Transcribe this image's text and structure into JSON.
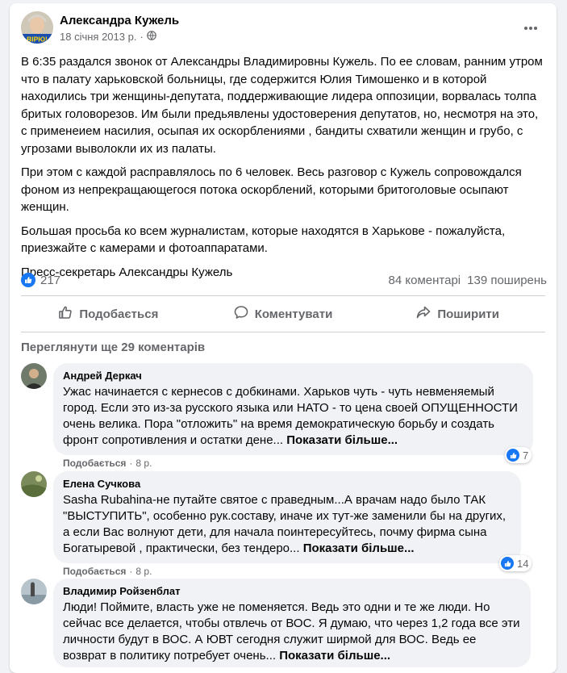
{
  "post": {
    "author": "Александра Кужель",
    "avatar_badge": "ВІРЮ!",
    "date": "18 січня 2013 р.",
    "separator": "·",
    "privacy_icon": "globe-icon",
    "more_icon": "more-horizontal-icon",
    "paragraphs": [
      "В 6:35 раздался звонок от Александры Владимировны Кужель. По ее словам, ранним утром что в палату  харьковской больницы, где содержится Юлия Тимошенко и в которой находились три женщины-депутата, поддерживающие лидера оппозиции,  ворвалась толпа бритых головорезов. Им были предьявлены удостоверения депутатов, но, несмотря на это, с применеием насилия, осыпая их  оскорблениями  , бандиты  схватили    женщин  и грубо, с угрозами    выволокли их из палаты.",
      "При этом с каждой расправлялось по 6 человек. Весь разговор с Кужель сопровождался фоном из непрекращающегося потока оскорблений, которыми бритоголовые осыпают женщин.",
      " Большая просьба ко всем журналистам, которые находятся в Харькове - пожалуйста, приезжайте с камерами и фотоаппаратами.",
      "Пресс-секретарь  Александры Кужель"
    ]
  },
  "stats": {
    "reactions": "217",
    "comments": "84 коментарі",
    "shares": "139 поширень"
  },
  "actions": {
    "like": "Подобається",
    "comment": "Коментувати",
    "share": "Поширити"
  },
  "view_more_comments": "Переглянути ще 29 коментарів",
  "comments": [
    {
      "author": "Андрей Деркач",
      "text": "Ужас начинается с кернесов с добкинами. Харьков чуть - чуть невменяемый город. Если это из-за русского языка или НАТО - то цена своей ОПУЩЕННОСТИ очень велика. Пора \"отложить\" на время демократическую борьбу и создать фронт сопротивления и остатки дене... ",
      "see_more": "Показати більше...",
      "reactions": "7",
      "like_label": "Подобається",
      "dot": "·",
      "time": "8 р."
    },
    {
      "author": "Елена Сучкова",
      "text": "Sasha Rubahina-не путайте святое с праведным...А врачам надо было ТАК \"ВЫСТУПИТЬ\", особенно рук.составу, иначе их тут-же заменили бы на других, а если Вас волнуют дети, для начала поинтересуйтесь, почму фирма сына Богатыревой , практически, без тендеро... ",
      "see_more": "Показати більше...",
      "reactions": "14",
      "like_label": "Подобається",
      "dot": "·",
      "time": "8 р."
    },
    {
      "author": "Владимир Ройзенблат",
      "text": "Люди! Поймите, власть уже не поменяется. Ведь это одни и те же люди. Но сейчас все делается, чтобы отвлечь от ВОС. Я думаю, что через 1,2 года все эти личности будут в ВОС. А ЮВТ сегодня служит ширмой для ВОС. Ведь ее возврат в политику потребует очень... ",
      "see_more": "Показати більше..."
    }
  ]
}
